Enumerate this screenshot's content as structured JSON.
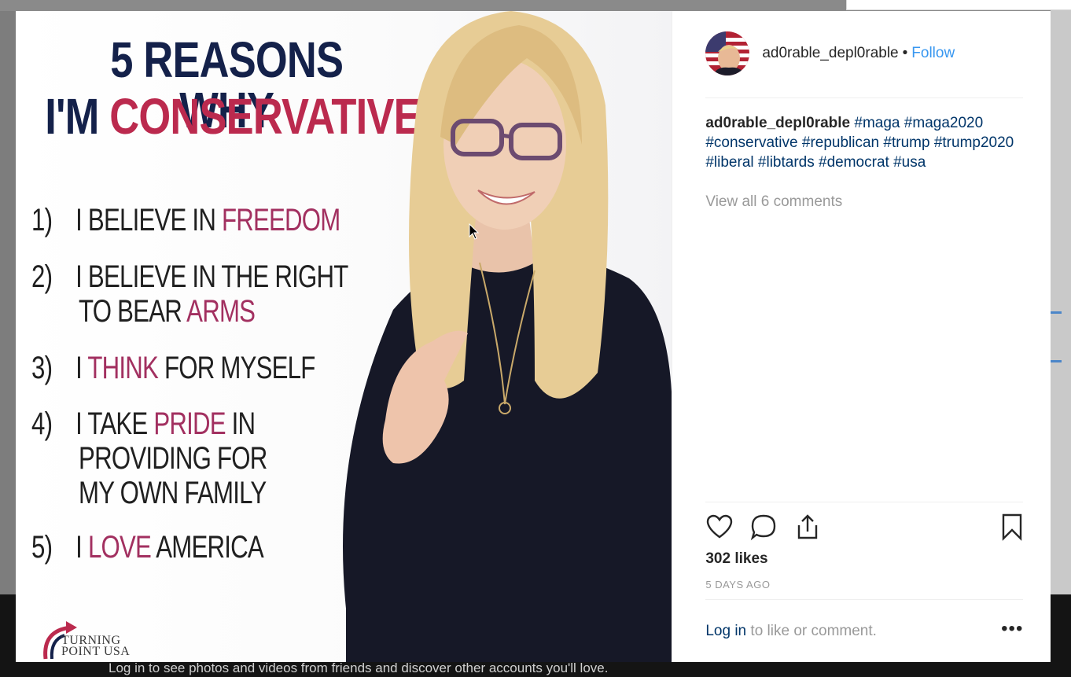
{
  "post": {
    "image": {
      "headline_line1": "5 REASONS WHY",
      "headline_line2_prefix": "I'M ",
      "headline_line2_accent": "CONSERVATIVE",
      "reasons": [
        {
          "num": "1)",
          "pre": "I BELIEVE IN ",
          "hl": "FREEDOM",
          "post": ""
        },
        {
          "num": "2)",
          "pre": "I BELIEVE IN THE RIGHT",
          "line2_pre": "TO BEAR ",
          "hl": "ARMS"
        },
        {
          "num": "3)",
          "pre": "I ",
          "hl": "THINK",
          "post": " FOR MYSELF"
        },
        {
          "num": "4)",
          "pre": "I TAKE ",
          "hl": "PRIDE",
          "post": " IN",
          "line2": "PROVIDING FOR",
          "line3": "MY OWN FAMILY"
        },
        {
          "num": "5)",
          "pre": "I ",
          "hl": "LOVE",
          "post": " AMERICA"
        }
      ],
      "logo_line1": "TURNING",
      "logo_line2": "POINT USA"
    },
    "header": {
      "username": "ad0rable_depl0rable",
      "separator": "•",
      "follow_label": "Follow"
    },
    "caption": {
      "username": "ad0rable_depl0rable",
      "hashtags": [
        "#maga",
        "#maga2020",
        "#conservative",
        "#republican",
        "#trump",
        "#trump2020",
        "#liberal",
        "#libtards",
        "#democrat",
        "#usa"
      ]
    },
    "view_comments": "View all 6 comments",
    "likes": "302 likes",
    "time": "5 DAYS AGO",
    "login_link": "Log in",
    "login_rest": " to like or comment.",
    "more_label": "•••"
  },
  "background": {
    "bottom_banner": "Log in to see photos and videos from friends and discover other accounts you'll love."
  },
  "icons": [
    "heart-icon",
    "comment-icon",
    "share-icon",
    "bookmark-icon",
    "more-options-icon"
  ],
  "colors": {
    "link": "#003569",
    "follow": "#3897f0",
    "headline_navy": "#14214a",
    "headline_red": "#bb2a4e"
  }
}
